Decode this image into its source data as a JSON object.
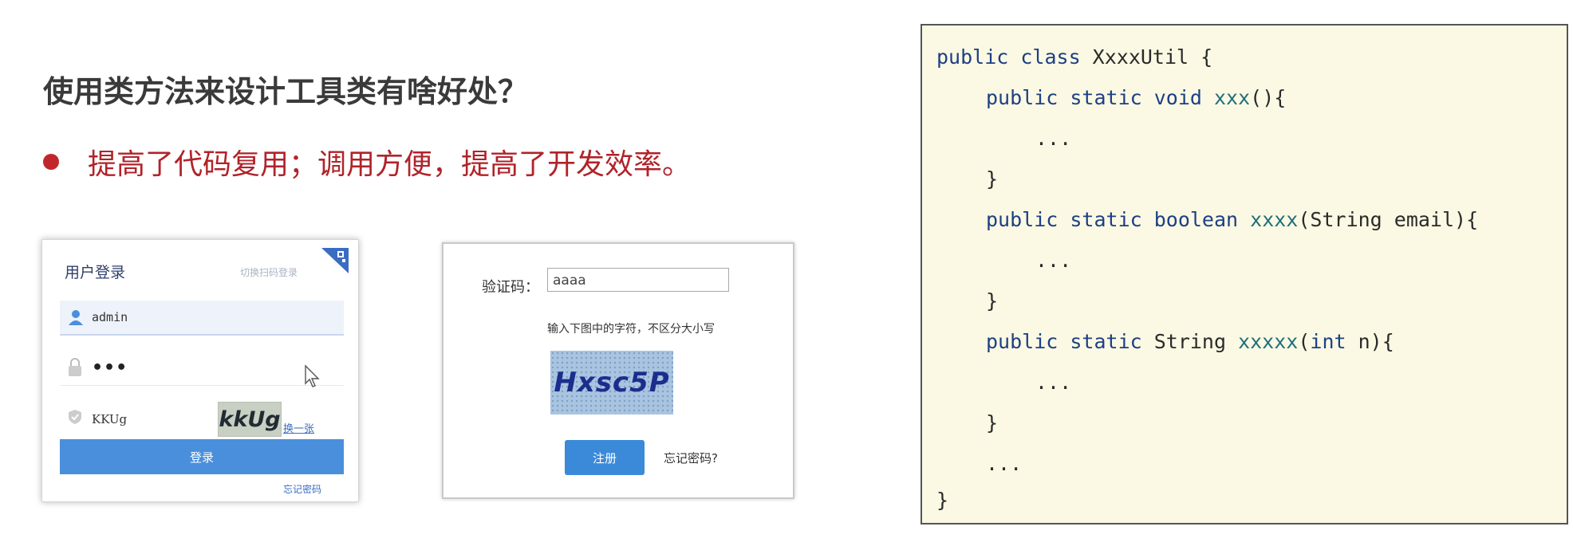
{
  "slide": {
    "heading": "使用类方法来设计工具类有啥好处？",
    "bullet": "提高了代码复用；调用方便，提高了开发效率。"
  },
  "login_form": {
    "title": "用户登录",
    "qr_link": "切换扫码登录",
    "username_value": "admin",
    "password_value": "•••",
    "captcha_input": "KKUg",
    "captcha_image_text": "kkUg",
    "refresh_link": "换一张",
    "login_button": "登录",
    "forgot_link": "忘记密码"
  },
  "register_form": {
    "captcha_label": "验证码：",
    "captcha_value": "aaaa",
    "hint": "输入下图中的字符，不区分大小写",
    "captcha_image_text": "Hxsc5P",
    "register_button": "注册",
    "forgot_link": "忘记密码?"
  },
  "code": {
    "line1": {
      "kw": "public class ",
      "plain": "XxxxUtil {"
    },
    "line2": {
      "kw": "public static void ",
      "fn": "xxx",
      "plain": "(){"
    },
    "line3": "...",
    "line4": "}",
    "line5": {
      "kw": "public static boolean ",
      "fn": "xxxx",
      "plain": "(String email){"
    },
    "line6": "...",
    "line7": "}",
    "line8": {
      "kw": "public static ",
      "type": "String ",
      "fn": "xxxxx",
      "p1": "(",
      "kw2": "int",
      "plain": " n){"
    },
    "line9": "...",
    "line10": "}",
    "line11": "...",
    "line12": "}"
  },
  "colors": {
    "heading": "#3a3a3a",
    "bullet": "#b0232a",
    "code_bg": "#fbf9e3",
    "keyword": "#1d3f85",
    "method": "#1f6f7c",
    "login_button": "#4a8fdc"
  }
}
